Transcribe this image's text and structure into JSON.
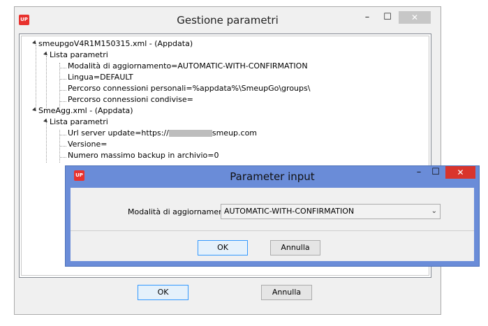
{
  "main_window": {
    "logo": "UP",
    "title": "Gestione parametri",
    "controls": {
      "minimize": "–",
      "maximize": "☐",
      "close": "✕"
    },
    "tree": [
      {
        "text": "smeupgoV4R1M150315.xml - (Appdata)",
        "level": 0,
        "expanded": true
      },
      {
        "text": "Lista parametri",
        "level": 1,
        "expanded": true
      },
      {
        "text": "Modalità di aggiornamento=AUTOMATIC-WITH-CONFIRMATION",
        "level": 2
      },
      {
        "text": "Lingua=DEFAULT",
        "level": 2
      },
      {
        "text": "Percorso connessioni personali=%appdata%\\SmeupGo\\groups\\",
        "level": 2
      },
      {
        "text": "Percorso connessioni condivise=",
        "level": 2
      },
      {
        "text": "SmeAgg.xml - (Appdata)",
        "level": 0,
        "expanded": true
      },
      {
        "text": "Lista parametri",
        "level": 1,
        "expanded": true
      },
      {
        "text": "Url server update=https://",
        "suffix": "smeup.com",
        "level": 2,
        "redacted": true
      },
      {
        "text": "Versione=",
        "level": 2
      },
      {
        "text": "Numero massimo backup in archivio=0",
        "level": 2
      }
    ],
    "ok_label": "OK",
    "cancel_label": "Annulla"
  },
  "dialog": {
    "logo": "UP",
    "title": "Parameter input",
    "controls": {
      "minimize": "–",
      "maximize": "☐",
      "close": "✕"
    },
    "field_label": "Modalità di aggiornamento",
    "field_value": "AUTOMATIC-WITH-CONFIRMATION",
    "ok_label": "OK",
    "cancel_label": "Annulla"
  },
  "colors": {
    "logo": "#e8322e",
    "dialog_frame": "#6a8cd8",
    "close_active": "#d9342c"
  },
  "icons": [
    "app-logo-icon",
    "minimize-icon",
    "maximize-icon",
    "close-icon",
    "expand-triangle-icon",
    "chevron-down-icon"
  ]
}
